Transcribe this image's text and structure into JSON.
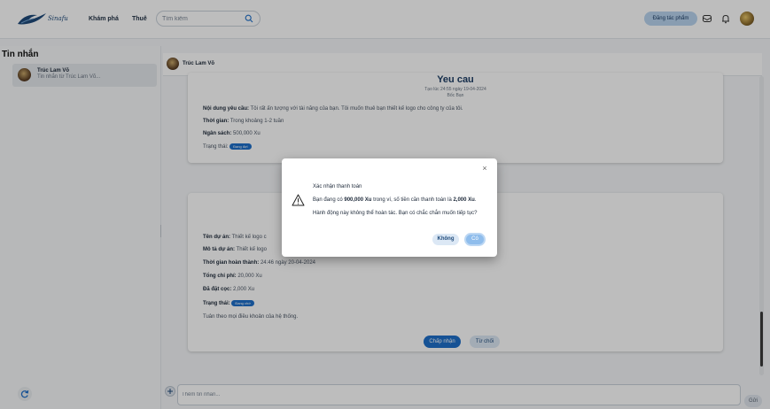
{
  "header": {
    "logo_text": "Sinafu",
    "nav": [
      "Khám phá",
      "Thuê"
    ],
    "search_placeholder": "Tìm kiếm",
    "post_button": "Đăng tác phẩm"
  },
  "sidebar": {
    "title": "Tin nhắn",
    "conversations": [
      {
        "name": "Trúc Lam Võ",
        "preview": "Tin nhắn từ Trúc Lam Võ..."
      }
    ]
  },
  "chat": {
    "contact_name": "Trúc Lam Võ",
    "request_card": {
      "title": "Yeu cau",
      "created": "Tạo lúc 24:55 ngày 19-04-2024",
      "author": "Bốc Bạn",
      "content_label": "Nội dung yêu cầu:",
      "content_value": "Tôi rất ấn tượng với tài năng của bạn. Tôi muốn thuê bạn thiết kế logo cho công ty của tôi.",
      "time_label": "Thời gian:",
      "time_value": "Trong khoảng 1-2 tuần",
      "budget_label": "Ngân sách:",
      "budget_value": "500,000 Xu",
      "status_label": "Trạng thái:",
      "status_badge": "Đang đợi"
    },
    "project_card": {
      "name_label": "Tên dự án:",
      "name_value": "Thiết kế logo c",
      "desc_label": "Mô tả dự án:",
      "desc_value": "Thiết kế logo",
      "deadline_label": "Thời gian hoàn thành:",
      "deadline_value": "24:46 ngày 20-04-2024",
      "cost_label": "Tổng chi phí:",
      "cost_value": "20,000 Xu",
      "deposit_label": "Đã đặt cọc:",
      "deposit_value": "2,000 Xu",
      "status_label": "Trạng thái:",
      "status_badge": "Đang chờ",
      "terms": "Tuân theo mọi điều khoản của hệ thống.",
      "accept_button": "Chấp nhận",
      "reject_button": "Từ chối"
    },
    "input_placeholder": "Thêm tin nhắn...",
    "send_button": "Gửi"
  },
  "modal": {
    "title": "Xác nhận thanh toán",
    "line1_prefix": "Bạn đang có ",
    "balance": "900,000 Xu",
    "line1_middle": " trong ví, số tiền cần thanh toán là ",
    "amount": "2,000 Xu",
    "line1_suffix": ".",
    "line2": "Hành động này không thể hoàn tác. Bạn có chắc chắn muốn tiếp tục?",
    "no_button": "Không",
    "yes_button": "Có",
    "close_symbol": "×"
  },
  "colors": {
    "accent": "#1e6fc9",
    "primary_light": "#b9d4ef",
    "title": "#1e3f66"
  }
}
